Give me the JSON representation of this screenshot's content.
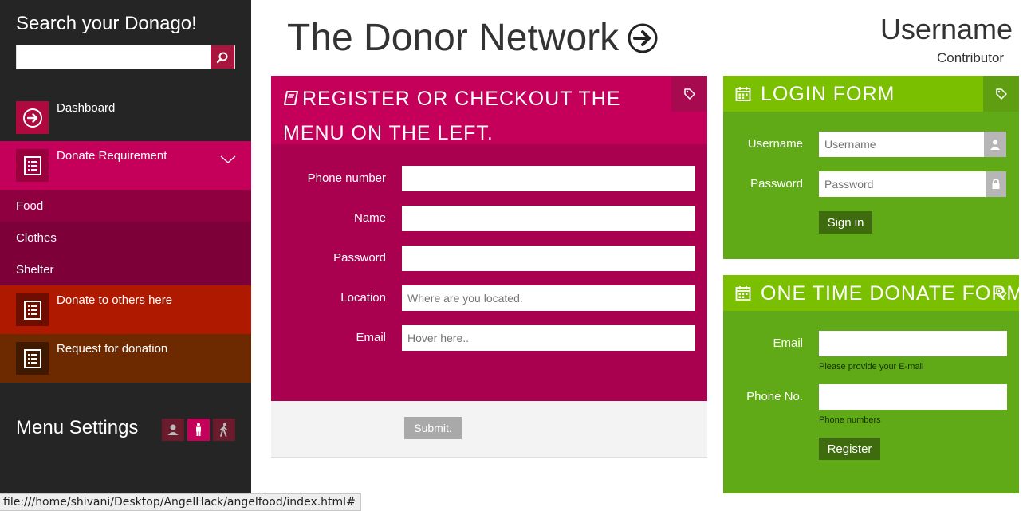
{
  "sidebar": {
    "search_title": "Search your Donago!",
    "search_value": "",
    "items": [
      {
        "label": "Dashboard",
        "bg": "#252525",
        "icon_bg": "#b0093f",
        "icon": "arrow-right-circle-icon"
      },
      {
        "label": "Donate Requirement",
        "bg": "#c4005a",
        "icon_bg": "#98003e",
        "icon": "list-icon"
      },
      {
        "label": "Donate to others here",
        "bg": "#ae1900",
        "icon_bg": "#6d0e00",
        "icon": "list-icon"
      },
      {
        "label": "Request for donation",
        "bg": "#6d2a00",
        "icon_bg": "#3f1900",
        "icon": "list-icon"
      }
    ],
    "sub_items": [
      "Food",
      "Clothes",
      "Shelter"
    ],
    "menu_settings_label": "Menu Settings"
  },
  "header": {
    "title": "The Donor Network",
    "username": "Username",
    "role": "Contributor"
  },
  "register_panel": {
    "title": "REGISTER OR CHECKOUT THE MENU ON THE LEFT.",
    "fields": [
      {
        "label": "Phone number",
        "placeholder": ""
      },
      {
        "label": "Name",
        "placeholder": ""
      },
      {
        "label": "Password",
        "placeholder": ""
      },
      {
        "label": "Location",
        "placeholder": "Where are you located."
      },
      {
        "label": "Email",
        "placeholder": "Hover here.."
      }
    ],
    "submit_label": "Submit."
  },
  "login_panel": {
    "title": "LOGIN FORM",
    "username_label": "Username",
    "username_placeholder": "Username",
    "password_label": "Password",
    "password_placeholder": "Password",
    "signin_label": "Sign in"
  },
  "donate_panel": {
    "title": "ONE TIME DONATE FORM",
    "email_label": "Email",
    "email_hint": "Please provide your E-mail",
    "phone_label": "Phone No.",
    "phone_hint": "Phone numbers",
    "register_label": "Register"
  },
  "status_bar": {
    "url": "file:///home/shivani/Desktop/AngelHack/angelfood/index.html#"
  },
  "colors": {
    "accent_magenta": "#c4005a",
    "accent_green": "#7ac000"
  }
}
